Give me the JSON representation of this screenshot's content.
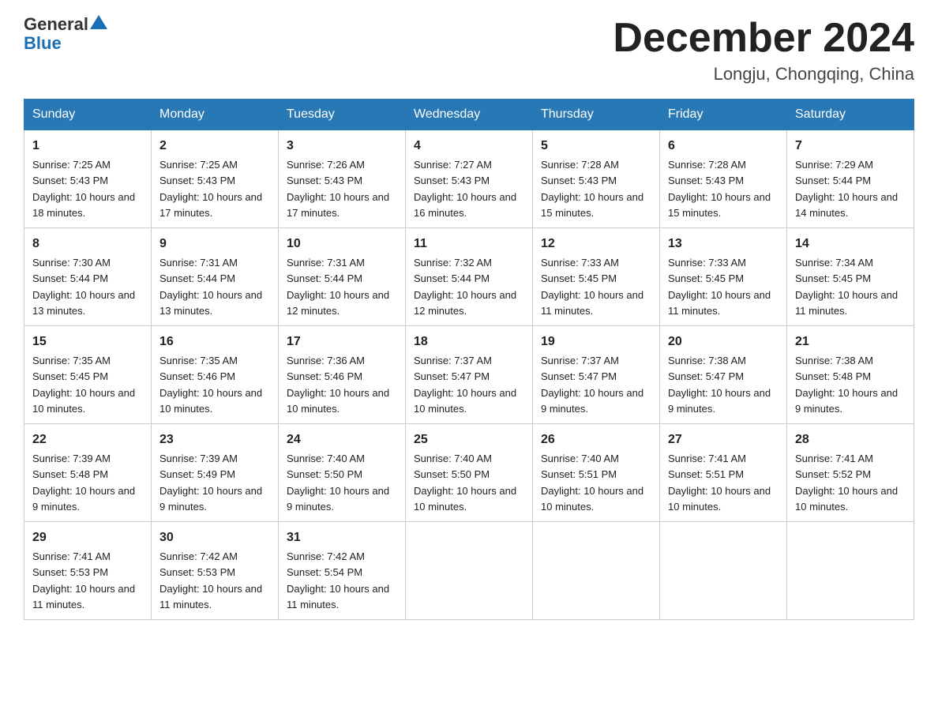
{
  "header": {
    "logo_general": "General",
    "logo_blue": "Blue",
    "month_title": "December 2024",
    "location": "Longju, Chongqing, China"
  },
  "days_of_week": [
    "Sunday",
    "Monday",
    "Tuesday",
    "Wednesday",
    "Thursday",
    "Friday",
    "Saturday"
  ],
  "weeks": [
    [
      {
        "day": "1",
        "sunrise": "7:25 AM",
        "sunset": "5:43 PM",
        "daylight": "10 hours and 18 minutes."
      },
      {
        "day": "2",
        "sunrise": "7:25 AM",
        "sunset": "5:43 PM",
        "daylight": "10 hours and 17 minutes."
      },
      {
        "day": "3",
        "sunrise": "7:26 AM",
        "sunset": "5:43 PM",
        "daylight": "10 hours and 17 minutes."
      },
      {
        "day": "4",
        "sunrise": "7:27 AM",
        "sunset": "5:43 PM",
        "daylight": "10 hours and 16 minutes."
      },
      {
        "day": "5",
        "sunrise": "7:28 AM",
        "sunset": "5:43 PM",
        "daylight": "10 hours and 15 minutes."
      },
      {
        "day": "6",
        "sunrise": "7:28 AM",
        "sunset": "5:43 PM",
        "daylight": "10 hours and 15 minutes."
      },
      {
        "day": "7",
        "sunrise": "7:29 AM",
        "sunset": "5:44 PM",
        "daylight": "10 hours and 14 minutes."
      }
    ],
    [
      {
        "day": "8",
        "sunrise": "7:30 AM",
        "sunset": "5:44 PM",
        "daylight": "10 hours and 13 minutes."
      },
      {
        "day": "9",
        "sunrise": "7:31 AM",
        "sunset": "5:44 PM",
        "daylight": "10 hours and 13 minutes."
      },
      {
        "day": "10",
        "sunrise": "7:31 AM",
        "sunset": "5:44 PM",
        "daylight": "10 hours and 12 minutes."
      },
      {
        "day": "11",
        "sunrise": "7:32 AM",
        "sunset": "5:44 PM",
        "daylight": "10 hours and 12 minutes."
      },
      {
        "day": "12",
        "sunrise": "7:33 AM",
        "sunset": "5:45 PM",
        "daylight": "10 hours and 11 minutes."
      },
      {
        "day": "13",
        "sunrise": "7:33 AM",
        "sunset": "5:45 PM",
        "daylight": "10 hours and 11 minutes."
      },
      {
        "day": "14",
        "sunrise": "7:34 AM",
        "sunset": "5:45 PM",
        "daylight": "10 hours and 11 minutes."
      }
    ],
    [
      {
        "day": "15",
        "sunrise": "7:35 AM",
        "sunset": "5:45 PM",
        "daylight": "10 hours and 10 minutes."
      },
      {
        "day": "16",
        "sunrise": "7:35 AM",
        "sunset": "5:46 PM",
        "daylight": "10 hours and 10 minutes."
      },
      {
        "day": "17",
        "sunrise": "7:36 AM",
        "sunset": "5:46 PM",
        "daylight": "10 hours and 10 minutes."
      },
      {
        "day": "18",
        "sunrise": "7:37 AM",
        "sunset": "5:47 PM",
        "daylight": "10 hours and 10 minutes."
      },
      {
        "day": "19",
        "sunrise": "7:37 AM",
        "sunset": "5:47 PM",
        "daylight": "10 hours and 9 minutes."
      },
      {
        "day": "20",
        "sunrise": "7:38 AM",
        "sunset": "5:47 PM",
        "daylight": "10 hours and 9 minutes."
      },
      {
        "day": "21",
        "sunrise": "7:38 AM",
        "sunset": "5:48 PM",
        "daylight": "10 hours and 9 minutes."
      }
    ],
    [
      {
        "day": "22",
        "sunrise": "7:39 AM",
        "sunset": "5:48 PM",
        "daylight": "10 hours and 9 minutes."
      },
      {
        "day": "23",
        "sunrise": "7:39 AM",
        "sunset": "5:49 PM",
        "daylight": "10 hours and 9 minutes."
      },
      {
        "day": "24",
        "sunrise": "7:40 AM",
        "sunset": "5:50 PM",
        "daylight": "10 hours and 9 minutes."
      },
      {
        "day": "25",
        "sunrise": "7:40 AM",
        "sunset": "5:50 PM",
        "daylight": "10 hours and 10 minutes."
      },
      {
        "day": "26",
        "sunrise": "7:40 AM",
        "sunset": "5:51 PM",
        "daylight": "10 hours and 10 minutes."
      },
      {
        "day": "27",
        "sunrise": "7:41 AM",
        "sunset": "5:51 PM",
        "daylight": "10 hours and 10 minutes."
      },
      {
        "day": "28",
        "sunrise": "7:41 AM",
        "sunset": "5:52 PM",
        "daylight": "10 hours and 10 minutes."
      }
    ],
    [
      {
        "day": "29",
        "sunrise": "7:41 AM",
        "sunset": "5:53 PM",
        "daylight": "10 hours and 11 minutes."
      },
      {
        "day": "30",
        "sunrise": "7:42 AM",
        "sunset": "5:53 PM",
        "daylight": "10 hours and 11 minutes."
      },
      {
        "day": "31",
        "sunrise": "7:42 AM",
        "sunset": "5:54 PM",
        "daylight": "10 hours and 11 minutes."
      },
      null,
      null,
      null,
      null
    ]
  ]
}
